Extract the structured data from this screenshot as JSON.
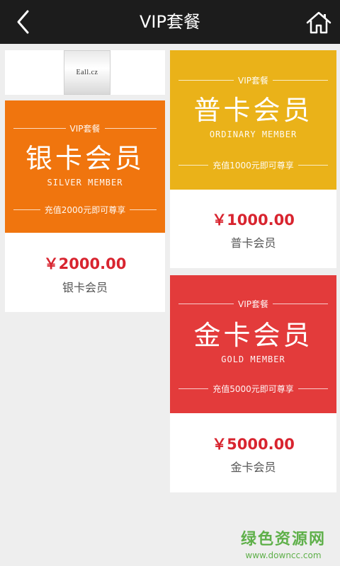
{
  "header": {
    "title": "VIP套餐",
    "back_icon": "chevron-left-icon",
    "home_icon": "home-icon"
  },
  "logo": {
    "text": "Eall.cz"
  },
  "cards": {
    "silver": {
      "tag": "VIP套餐",
      "title": "银卡会员",
      "subtitle": "SILVER MEMBER",
      "condition": "充值2000元即可尊享",
      "price": "￥2000.00",
      "name": "银卡会员",
      "color": "#f0750e"
    },
    "ordinary": {
      "tag": "VIP套餐",
      "title": "普卡会员",
      "subtitle": "ORDINARY MEMBER",
      "condition": "充值1000元即可尊享",
      "price": "￥1000.00",
      "name": "普卡会员",
      "color": "#eab219"
    },
    "gold": {
      "tag": "VIP套餐",
      "title": "金卡会员",
      "subtitle": "GOLD MEMBER",
      "condition": "充值5000元即可尊享",
      "price": "￥5000.00",
      "name": "金卡会员",
      "color": "#e33b3b"
    }
  },
  "watermark": {
    "cn": "绿色资源网",
    "url": "www.downcc.com"
  }
}
